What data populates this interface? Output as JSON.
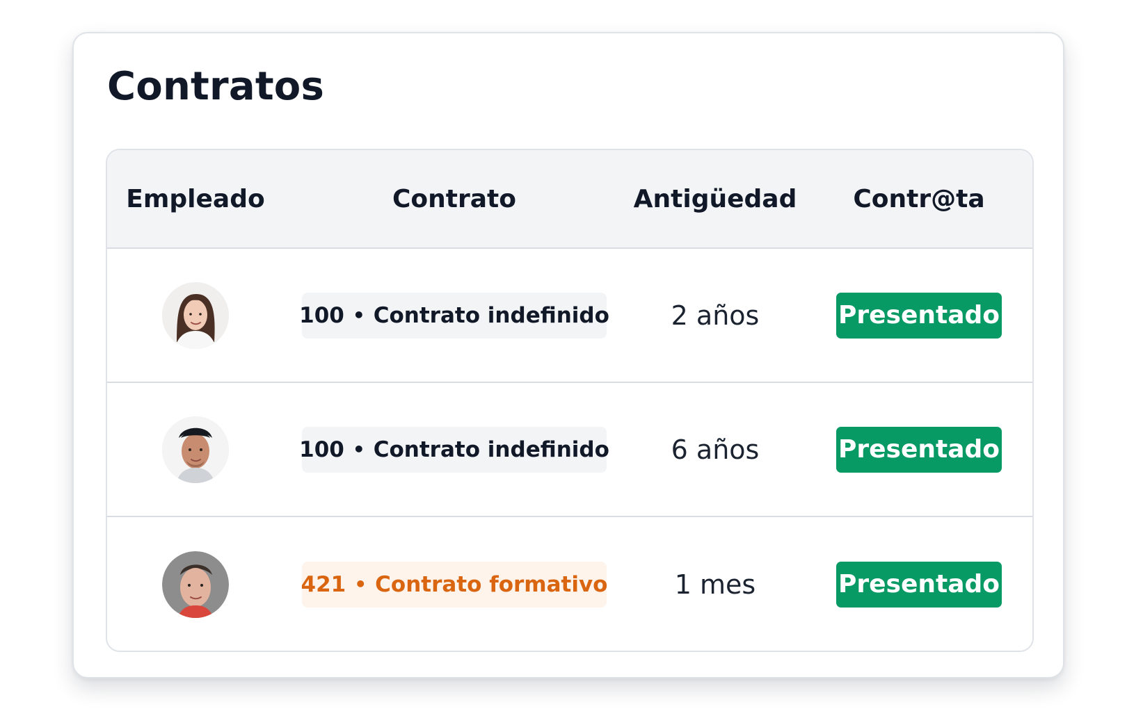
{
  "card": {
    "title": "Contratos"
  },
  "table": {
    "headers": [
      "Empleado",
      "Contrato",
      "Antigüedad",
      "Contr@ta"
    ],
    "rows": [
      {
        "employee": {
          "avatar": "female-avatar",
          "avatar_colors": {
            "background": "#f1efee",
            "hair": "#4a2f25",
            "skin": "#f2cbb6",
            "shirt": "#f7f7f7"
          }
        },
        "contract": {
          "code": "100",
          "separator": "•",
          "label": "Contrato indefinido",
          "variant": "default"
        },
        "seniority": "2 años",
        "status": "Presentado"
      },
      {
        "employee": {
          "avatar": "male-avatar",
          "avatar_colors": {
            "background": "#f4f4f4",
            "hair": "#16191f",
            "skin": "#c88c70",
            "shirt": "#cfd3d8"
          }
        },
        "contract": {
          "code": "100",
          "separator": "•",
          "label": "Contrato indefinido",
          "variant": "default"
        },
        "seniority": "6 años",
        "status": "Presentado"
      },
      {
        "employee": {
          "avatar": "male-avatar",
          "avatar_colors": {
            "background": "#8d8d8d",
            "hair": "#3b2f29",
            "skin": "#e2b49f",
            "shirt": "#d9463b"
          }
        },
        "contract": {
          "code": "421",
          "separator": "•",
          "label": "Contrato formativo",
          "variant": "formative"
        },
        "seniority": "1 mes",
        "status": "Presentado"
      }
    ]
  },
  "colors": {
    "title_text": "#111827",
    "header_background": "#f3f4f6",
    "border": "#dfe3e8",
    "default_pill_background": "#f3f4f6",
    "formative_pill_background": "#fff4ec",
    "formative_pill_text": "#d96510",
    "status_badge_background": "#079a65",
    "status_badge_text": "#ffffff"
  }
}
